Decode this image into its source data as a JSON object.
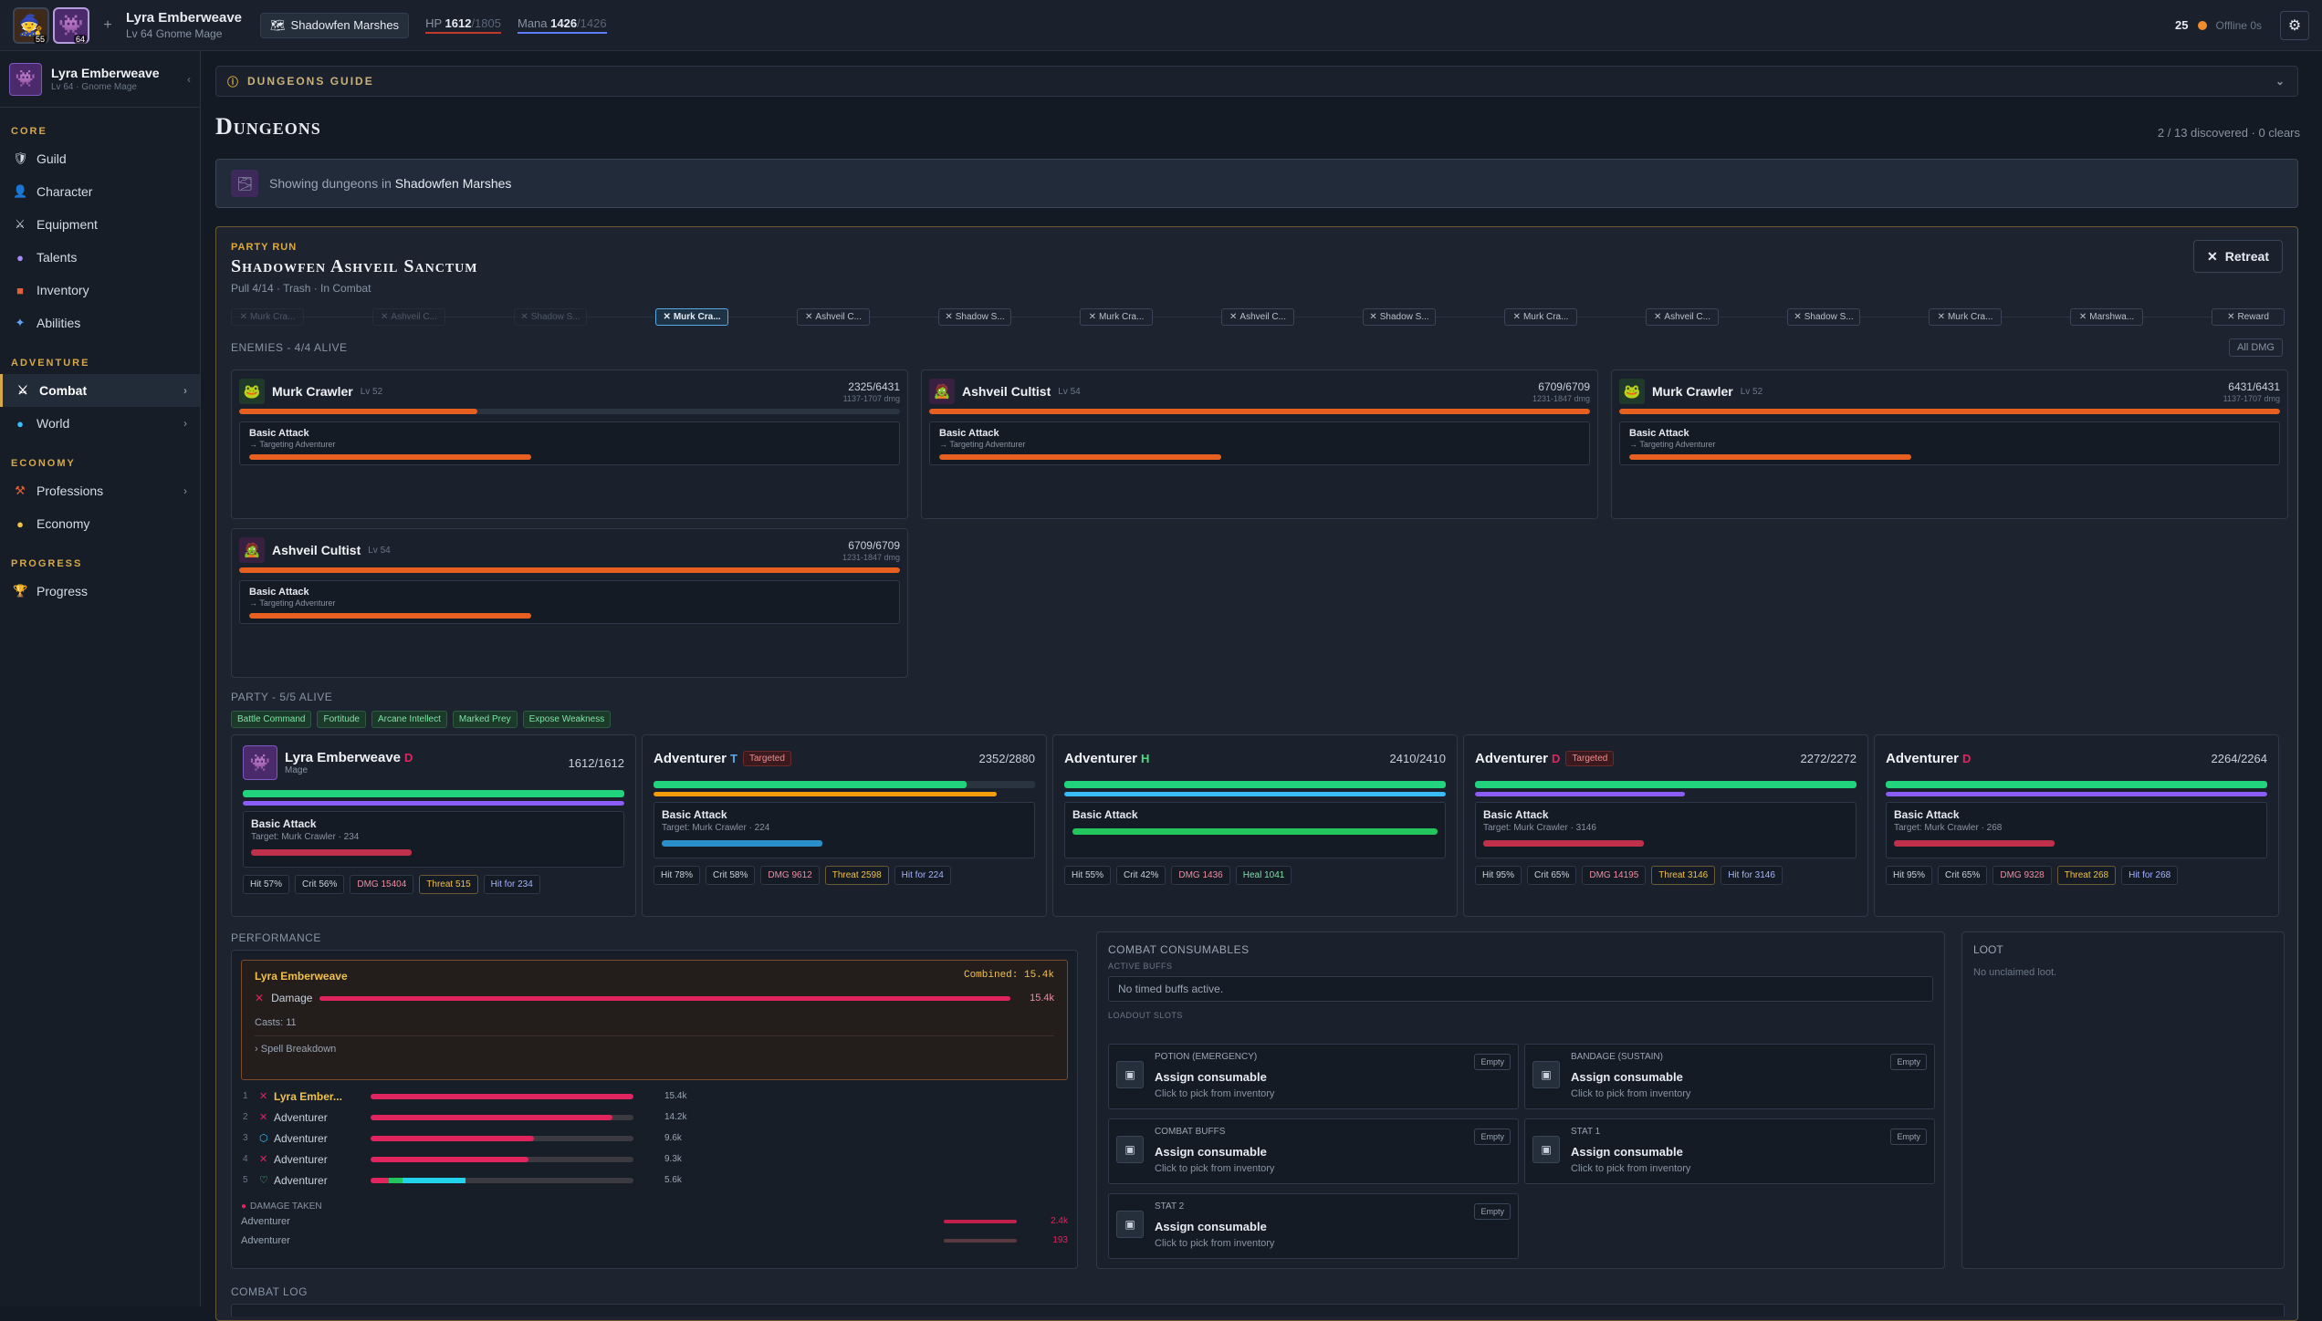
{
  "topbar": {
    "avatar1_level": "55",
    "avatar2_level": "64",
    "name": "Lyra Emberweave",
    "subtitle": "Lv 64 Gnome Mage",
    "location": "Shadowfen Marshes",
    "hp_label": "HP",
    "hp_value": "1612",
    "hp_max": "/1805",
    "mana_label": "Mana",
    "mana_value": "1426",
    "mana_max": "/1426",
    "gold": "25",
    "offline": "Offline 0s"
  },
  "sidebar": {
    "profile_name": "Lyra Emberweave",
    "profile_sub": "Lv 64 · Gnome Mage",
    "sections": {
      "core": "CORE",
      "adventure": "ADVENTURE",
      "economy": "ECONOMY",
      "progress": "PROGRESS"
    },
    "items": {
      "guild": "Guild",
      "character": "Character",
      "equipment": "Equipment",
      "talents": "Talents",
      "inventory": "Inventory",
      "abilities": "Abilities",
      "combat": "Combat",
      "world": "World",
      "professions": "Professions",
      "economy": "Economy",
      "progress": "Progress"
    }
  },
  "main": {
    "guide": "DUNGEONS GUIDE",
    "title": "Dungeons",
    "discovered": "2 / 13 discovered · 0 clears",
    "showing_prefix": "Showing dungeons in",
    "showing_zone": "Shadowfen Marshes"
  },
  "run": {
    "label": "PARTY RUN",
    "dungeon": "Shadowfen Ashveil Sanctum",
    "pull": "Pull 4/14 · Trash · In Combat",
    "retreat": "Retreat",
    "track": [
      "Murk Cra...",
      "Ashveil C...",
      "Shadow S...",
      "Murk Cra...",
      "Ashveil C...",
      "Shadow S...",
      "Murk Cra...",
      "Ashveil C...",
      "Shadow S...",
      "Murk Cra...",
      "Ashveil C...",
      "Shadow S...",
      "Murk Cra...",
      "Marshwa...",
      "Reward"
    ],
    "enemies_label": "ENEMIES - 4/4 ALIVE",
    "all_dmg": "All DMG",
    "enemies": [
      {
        "name": "Murk Crawler",
        "lv": "Lv 52",
        "hp": "2325/6431",
        "dmg": "1137-1707 dmg",
        "hp_frac": 0.36,
        "action": "Basic Attack",
        "target": "→ Targeting Adventurer",
        "cast_frac": 0.44
      },
      {
        "name": "Ashveil Cultist",
        "lv": "Lv 54",
        "hp": "6709/6709",
        "dmg": "1231-1847 dmg",
        "hp_frac": 1.0,
        "action": "Basic Attack",
        "target": "→ Targeting Adventurer",
        "cast_frac": 0.44
      },
      {
        "name": "Murk Crawler",
        "lv": "Lv 52",
        "hp": "6431/6431",
        "dmg": "1137-1707 dmg",
        "hp_frac": 1.0,
        "action": "Basic Attack",
        "target": "→ Targeting Adventurer",
        "cast_frac": 0.44
      },
      {
        "name": "Ashveil Cultist",
        "lv": "Lv 54",
        "hp": "6709/6709",
        "dmg": "1231-1847 dmg",
        "hp_frac": 1.0,
        "action": "Basic Attack",
        "target": "→ Targeting Adventurer",
        "cast_frac": 0.44
      }
    ],
    "party_label": "PARTY - 5/5 ALIVE",
    "buffs": [
      "Battle Command",
      "Fortitude",
      "Arcane Intellect",
      "Marked Prey",
      "Expose Weakness"
    ],
    "party": [
      {
        "name": "Lyra Emberweave",
        "role": "D",
        "role_color": "#e0245e",
        "sub": "Mage",
        "hp": "1612/1612",
        "hp_frac": 1.0,
        "res_frac": 1.0,
        "res_color": "#8b5cf6",
        "targeted": "",
        "action": "Basic Attack",
        "target": "Target: Murk Crawler · 234",
        "cast_frac": 0.44,
        "cast_color": "#c0304a",
        "hit": "Hit 57%",
        "crit": "Crit 56%",
        "dmg": "DMG 15404",
        "threat": "Threat 515",
        "last": "Hit for 234"
      },
      {
        "name": "Adventurer",
        "role": "T",
        "role_color": "#5aa9e6",
        "sub": "",
        "hp": "2352/2880",
        "hp_frac": 0.82,
        "res_frac": 0.9,
        "res_color": "#f59e0b",
        "targeted": "Targeted",
        "action": "Basic Attack",
        "target": "Target: Murk Crawler · 224",
        "cast_frac": 0.44,
        "cast_color": "#2b8fc9",
        "hit": "Hit 78%",
        "crit": "Crit 58%",
        "dmg": "DMG 9612",
        "threat": "Threat 2598",
        "last": "Hit for 224"
      },
      {
        "name": "Adventurer",
        "role": "H",
        "role_color": "#4ade80",
        "sub": "",
        "hp": "2410/2410",
        "hp_frac": 1.0,
        "res_frac": 1.0,
        "res_color": "#38bdf8",
        "targeted": "",
        "action": "Basic Attack",
        "target": "",
        "cast_frac": 1.0,
        "cast_color": "#22c55e",
        "hit": "Hit 55%",
        "crit": "Crit 42%",
        "dmg": "DMG 1436",
        "heal": "Heal 1041"
      },
      {
        "name": "Adventurer",
        "role": "D",
        "role_color": "#e0245e",
        "sub": "",
        "hp": "2272/2272",
        "hp_frac": 1.0,
        "res_frac": 0.55,
        "res_color": "#8b5cf6",
        "targeted": "Targeted",
        "action": "Basic Attack",
        "target": "Target: Murk Crawler · 3146",
        "cast_frac": 0.44,
        "cast_color": "#c0304a",
        "hit": "Hit 95%",
        "crit": "Crit 65%",
        "dmg": "DMG 14195",
        "threat": "Threat 3146",
        "last": "Hit for 3146"
      },
      {
        "name": "Adventurer",
        "role": "D",
        "role_color": "#e0245e",
        "sub": "",
        "hp": "2264/2264",
        "hp_frac": 1.0,
        "res_frac": 1.0,
        "res_color": "#8b5cf6",
        "targeted": "",
        "action": "Basic Attack",
        "target": "Target: Murk Crawler · 268",
        "cast_frac": 0.44,
        "cast_color": "#c0304a",
        "hit": "Hit 95%",
        "crit": "Crit 65%",
        "dmg": "DMG 9328",
        "threat": "Threat 268",
        "last": "Hit for 268"
      }
    ]
  },
  "performance": {
    "label": "PERFORMANCE",
    "top_name": "Lyra Emberweave",
    "combined": "Combined: 15.4k",
    "damage_label": "Damage",
    "damage_value": "15.4k",
    "casts": "Casts: 11",
    "spell_breakdown": "Spell Breakdown",
    "rank": [
      {
        "n": "1",
        "name": "Lyra Ember...",
        "value": "15.4k",
        "frac": 1.0,
        "color": "#e0245e"
      },
      {
        "n": "2",
        "name": "Adventurer",
        "value": "14.2k",
        "frac": 0.92,
        "color": "#e0245e"
      },
      {
        "n": "3",
        "name": "Adventurer",
        "value": "9.6k",
        "frac": 0.62,
        "color": "#e0245e"
      },
      {
        "n": "4",
        "name": "Adventurer",
        "value": "9.3k",
        "frac": 0.6,
        "color": "#e0245e"
      },
      {
        "n": "5",
        "name": "Adventurer",
        "value": "5.6k",
        "frac": 0.36,
        "color": "#22d3ee"
      }
    ],
    "damage_taken_label": "DAMAGE TAKEN",
    "taken": [
      {
        "name": "Adventurer",
        "value": "2.4k"
      },
      {
        "name": "Adventurer",
        "value": "193"
      }
    ]
  },
  "consumables": {
    "title": "COMBAT CONSUMABLES",
    "active_buffs": "ACTIVE BUFFS",
    "no_buffs": "No timed buffs active.",
    "loadout": "LOADOUT SLOTS",
    "slots": [
      {
        "type": "POTION (EMERGENCY)",
        "assign": "Assign consumable",
        "hint": "Click to pick from inventory",
        "empty": "Empty"
      },
      {
        "type": "BANDAGE (SUSTAIN)",
        "assign": "Assign consumable",
        "hint": "Click to pick from inventory",
        "empty": "Empty"
      },
      {
        "type": "COMBAT BUFFS",
        "assign": "Assign consumable",
        "hint": "Click to pick from inventory",
        "empty": "Empty"
      },
      {
        "type": "STAT 1",
        "assign": "Assign consumable",
        "hint": "Click to pick from inventory",
        "empty": "Empty"
      },
      {
        "type": "STAT 2",
        "assign": "Assign consumable",
        "hint": "Click to pick from inventory",
        "empty": "Empty"
      }
    ]
  },
  "loot": {
    "title": "LOOT",
    "empty": "No unclaimed loot."
  },
  "combat_log": "COMBAT LOG"
}
